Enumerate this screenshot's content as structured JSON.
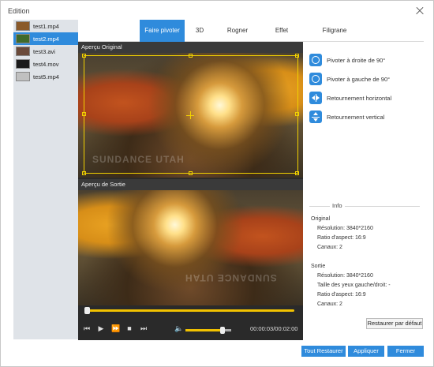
{
  "window": {
    "title": "Edition"
  },
  "files": [
    {
      "name": "test1.mp4",
      "thumb": "#8a5a2a"
    },
    {
      "name": "test2.mp4",
      "thumb": "#3f6a2a",
      "selected": true
    },
    {
      "name": "test3.avi",
      "thumb": "#6a4a3a"
    },
    {
      "name": "test4.mov",
      "thumb": "#1a1a1a"
    },
    {
      "name": "test5.mp4",
      "thumb": "#c0c0c0"
    }
  ],
  "tabs": [
    "Faire pivoter",
    "3D",
    "Rogner",
    "Effet",
    "Filigrane"
  ],
  "active_tab": 0,
  "preview": {
    "original_label": "Aperçu Original",
    "output_label": "Aperçu de Sortie",
    "watermark_text": "SUNDANCE UTAH",
    "time": "00:00:03/00:02:00",
    "progress": 0.01,
    "volume": 0.75
  },
  "actions": [
    {
      "label": "Pivoter à droite de 90°",
      "icon": "rotate-right-icon"
    },
    {
      "label": "Pivoter à gauche de 90°",
      "icon": "rotate-left-icon"
    },
    {
      "label": "Retournement horizontal",
      "icon": "flip-horizontal-icon"
    },
    {
      "label": "Retournement vertical",
      "icon": "flip-vertical-icon"
    }
  ],
  "info": {
    "legend": "Info",
    "original_heading": "Original",
    "original_resolution": "Résolution: 3840*2160",
    "original_ratio": "Ratio d'aspect: 16:9",
    "original_channels": "Canaux: 2",
    "output_heading": "Sortie",
    "output_resolution": "Résolution: 3840*2160",
    "output_eye_size": "Taille des yeux gauche/droit: -",
    "output_ratio": "Ratio d'aspect: 16:9",
    "output_channels": "Canaux: 2"
  },
  "buttons": {
    "restore_default": "Restaurer par défaut",
    "restore_all": "Tout Restaurer",
    "apply": "Appliquer",
    "close": "Fermer"
  },
  "colors": {
    "accent": "#2f8bdc",
    "crop": "#f2d200",
    "track": "#f2c200"
  }
}
